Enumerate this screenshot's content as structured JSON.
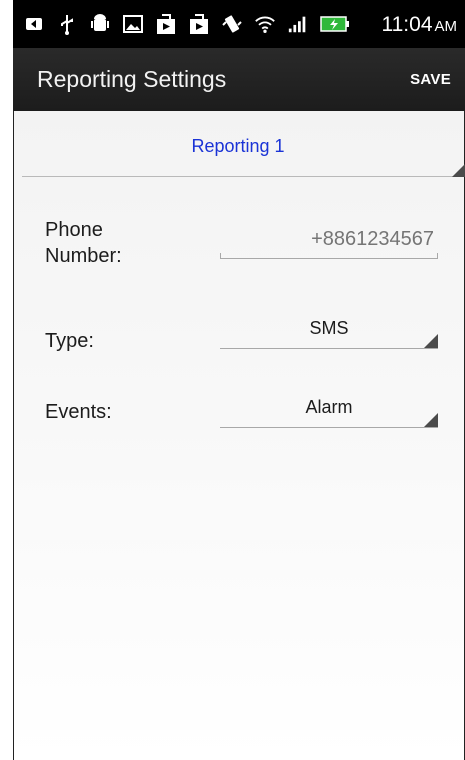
{
  "status_bar": {
    "time": "11:04",
    "ampm": "AM",
    "icons": [
      "back-arrow-icon",
      "usb-icon",
      "android-debug-icon",
      "image-icon",
      "download-icon",
      "download-icon",
      "vibrate-icon",
      "wifi-icon",
      "signal-icon",
      "battery-charging-icon"
    ]
  },
  "action_bar": {
    "title": "Reporting Settings",
    "save_label": "SAVE"
  },
  "report_selector": {
    "value": "Reporting 1",
    "color": "#1a33d6"
  },
  "form": {
    "phone": {
      "label": "Phone Number:",
      "label_line1": "Phone",
      "label_line2": "Number:",
      "value": "",
      "placeholder": "+8861234567"
    },
    "type": {
      "label": "Type:",
      "value": "SMS"
    },
    "events": {
      "label": "Events:",
      "value": "Alarm"
    }
  }
}
